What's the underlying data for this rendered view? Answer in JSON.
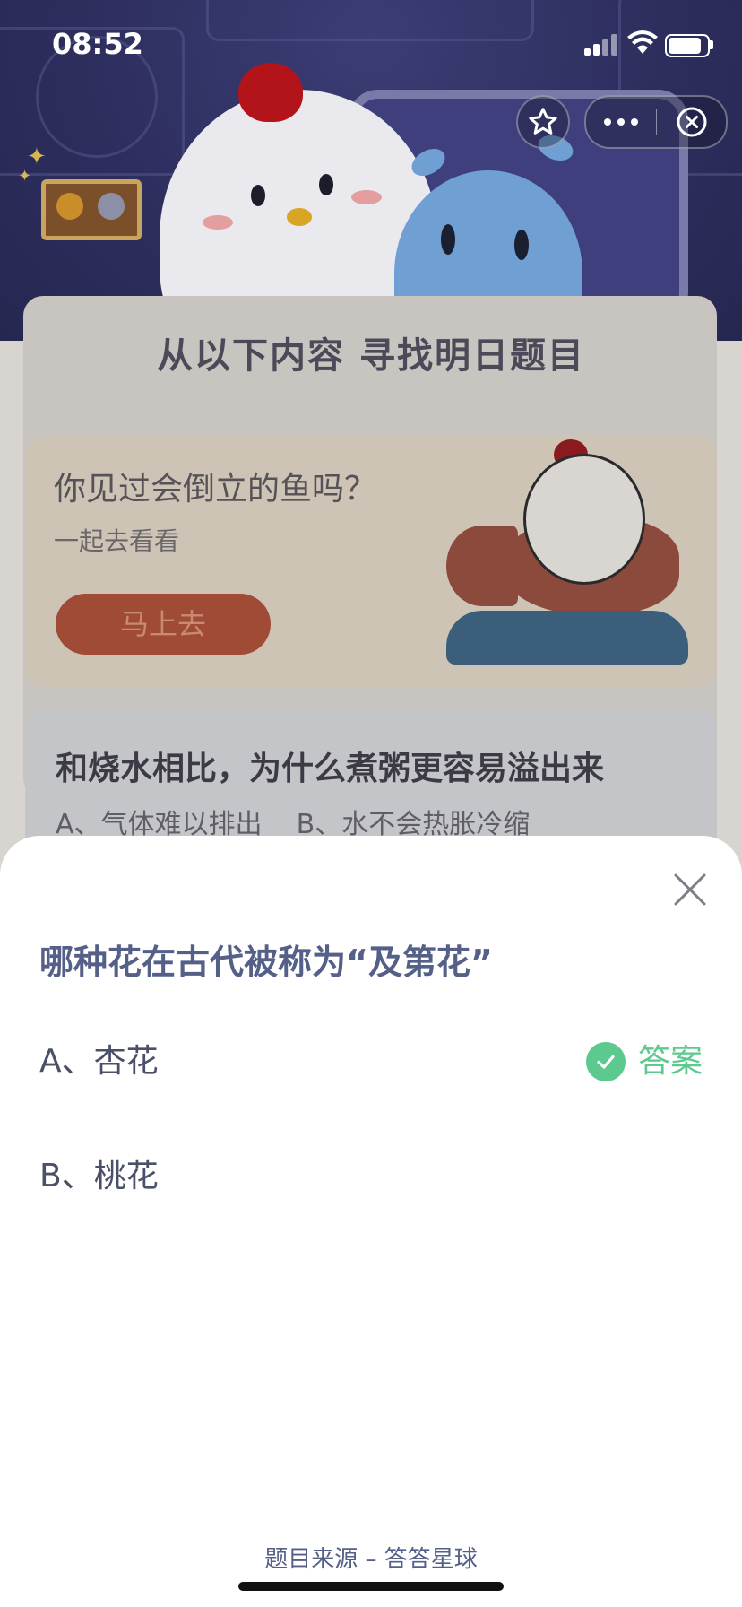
{
  "status_bar": {
    "time": "08:52"
  },
  "background": {
    "headline": "从以下内容  寻找明日题目",
    "promo": {
      "title": "你见过会倒立的鱼吗？",
      "subtitle": "一起去看看",
      "button": "马上去"
    },
    "question_card": {
      "title": "和烧水相比，为什么煮粥更容易溢出来",
      "options": "A、气体难以排出    B、水不会热胀冷缩"
    }
  },
  "sheet": {
    "question": "哪种花在古代被称为“及第花”",
    "options": [
      {
        "label": "A、杏花",
        "is_answer": true
      },
      {
        "label": "B、桃花",
        "is_answer": false
      }
    ],
    "answer_label": "答案",
    "source": "题目来源 – 答答星球"
  },
  "icons": {
    "star": "star-icon",
    "more": "more-dots-icon",
    "capsule_close": "close-circle-icon",
    "sheet_close": "close-icon",
    "check": "check-icon"
  },
  "colors": {
    "answer_green": "#5cc98e",
    "question_text": "#556089",
    "hero_bg": "#2c2d5c"
  }
}
